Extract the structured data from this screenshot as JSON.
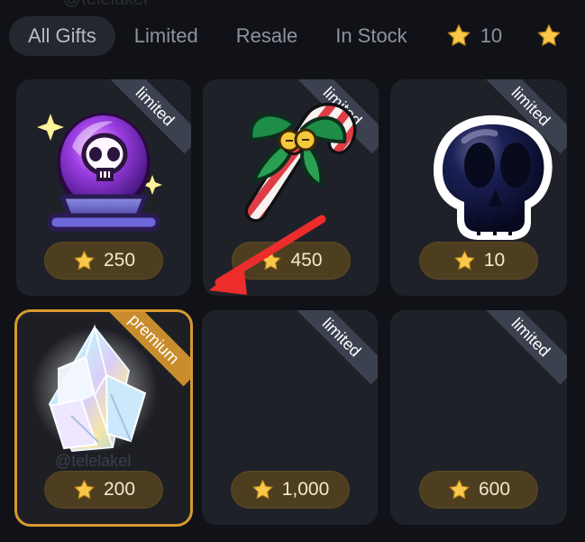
{
  "watermark_top": "@telelakel",
  "tabs": [
    {
      "label": "All Gifts",
      "active": true
    },
    {
      "label": "Limited",
      "active": false
    },
    {
      "label": "Resale",
      "active": false
    },
    {
      "label": "In Stock",
      "active": false
    },
    {
      "label": "10",
      "active": false,
      "icon": "star-icon"
    },
    {
      "label": "",
      "active": false,
      "icon": "star-icon"
    }
  ],
  "gifts": [
    {
      "name": "crystal-ball",
      "badge": "limited",
      "price": "250",
      "icon": "crystal-ball-skull-icon"
    },
    {
      "name": "candy-cane",
      "badge": "limited",
      "price": "450",
      "icon": "candy-cane-icon"
    },
    {
      "name": "skull",
      "badge": "limited",
      "price": "10",
      "icon": "skull-icon"
    },
    {
      "name": "diamond",
      "badge": "premium",
      "price": "200",
      "icon": "diamond-crystal-icon",
      "watermark": "@telelakel"
    },
    {
      "name": "empty-limited-1",
      "badge": "limited",
      "price": "1,000"
    },
    {
      "name": "empty-limited-2",
      "badge": "limited",
      "price": "600"
    }
  ],
  "colors": {
    "background": "#111217",
    "card": "#1f2128",
    "premium_border": "#d69a2e",
    "limited_ribbon": "#3b414e",
    "premium_ribbon": "#c98d2d",
    "arrow": "#ed2c2c",
    "star": "#f8c84a"
  }
}
